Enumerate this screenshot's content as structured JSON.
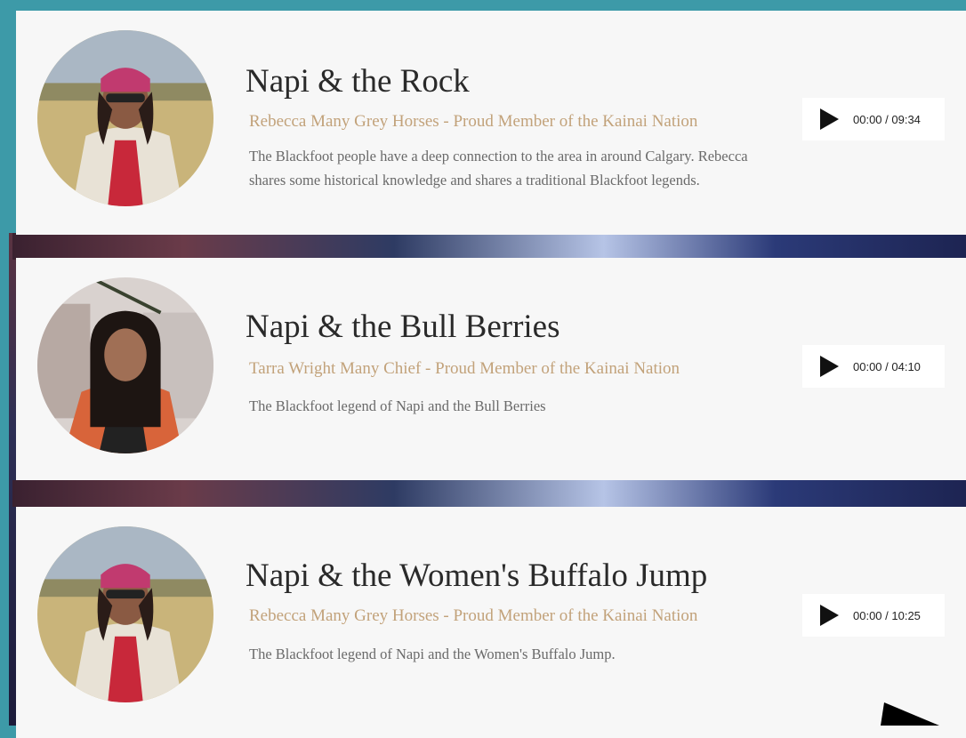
{
  "stories": [
    {
      "title": "Napi & the Rock",
      "author": "Rebecca Many Grey Horses - Proud Member of the Kainai Nation",
      "description": "The Blackfoot people have a deep connection to the area in around Calgary. Rebecca shares some historical knowledge and shares a traditional Blackfoot legends.",
      "time": "00:00 / 09:34"
    },
    {
      "title": "Napi & the Bull Berries",
      "author": "Tarra Wright Many Chief - Proud Member of the Kainai Nation",
      "description": "The Blackfoot legend of Napi and the Bull Berries",
      "time": "00:00 / 04:10"
    },
    {
      "title": "Napi & the Women's Buffalo Jump",
      "author": "Rebecca Many Grey Horses - Proud Member of the Kainai Nation",
      "description": "The Blackfoot legend of Napi and the Women's Buffalo Jump.",
      "time": "00:00 / 10:25"
    }
  ],
  "colors": {
    "frame": "#3d9aa8",
    "card_bg": "#f7f7f7",
    "author_text": "#c2a27a",
    "title_text": "#2a2a2a"
  },
  "icons": [
    "play-icon",
    "mouse-cursor-icon"
  ]
}
